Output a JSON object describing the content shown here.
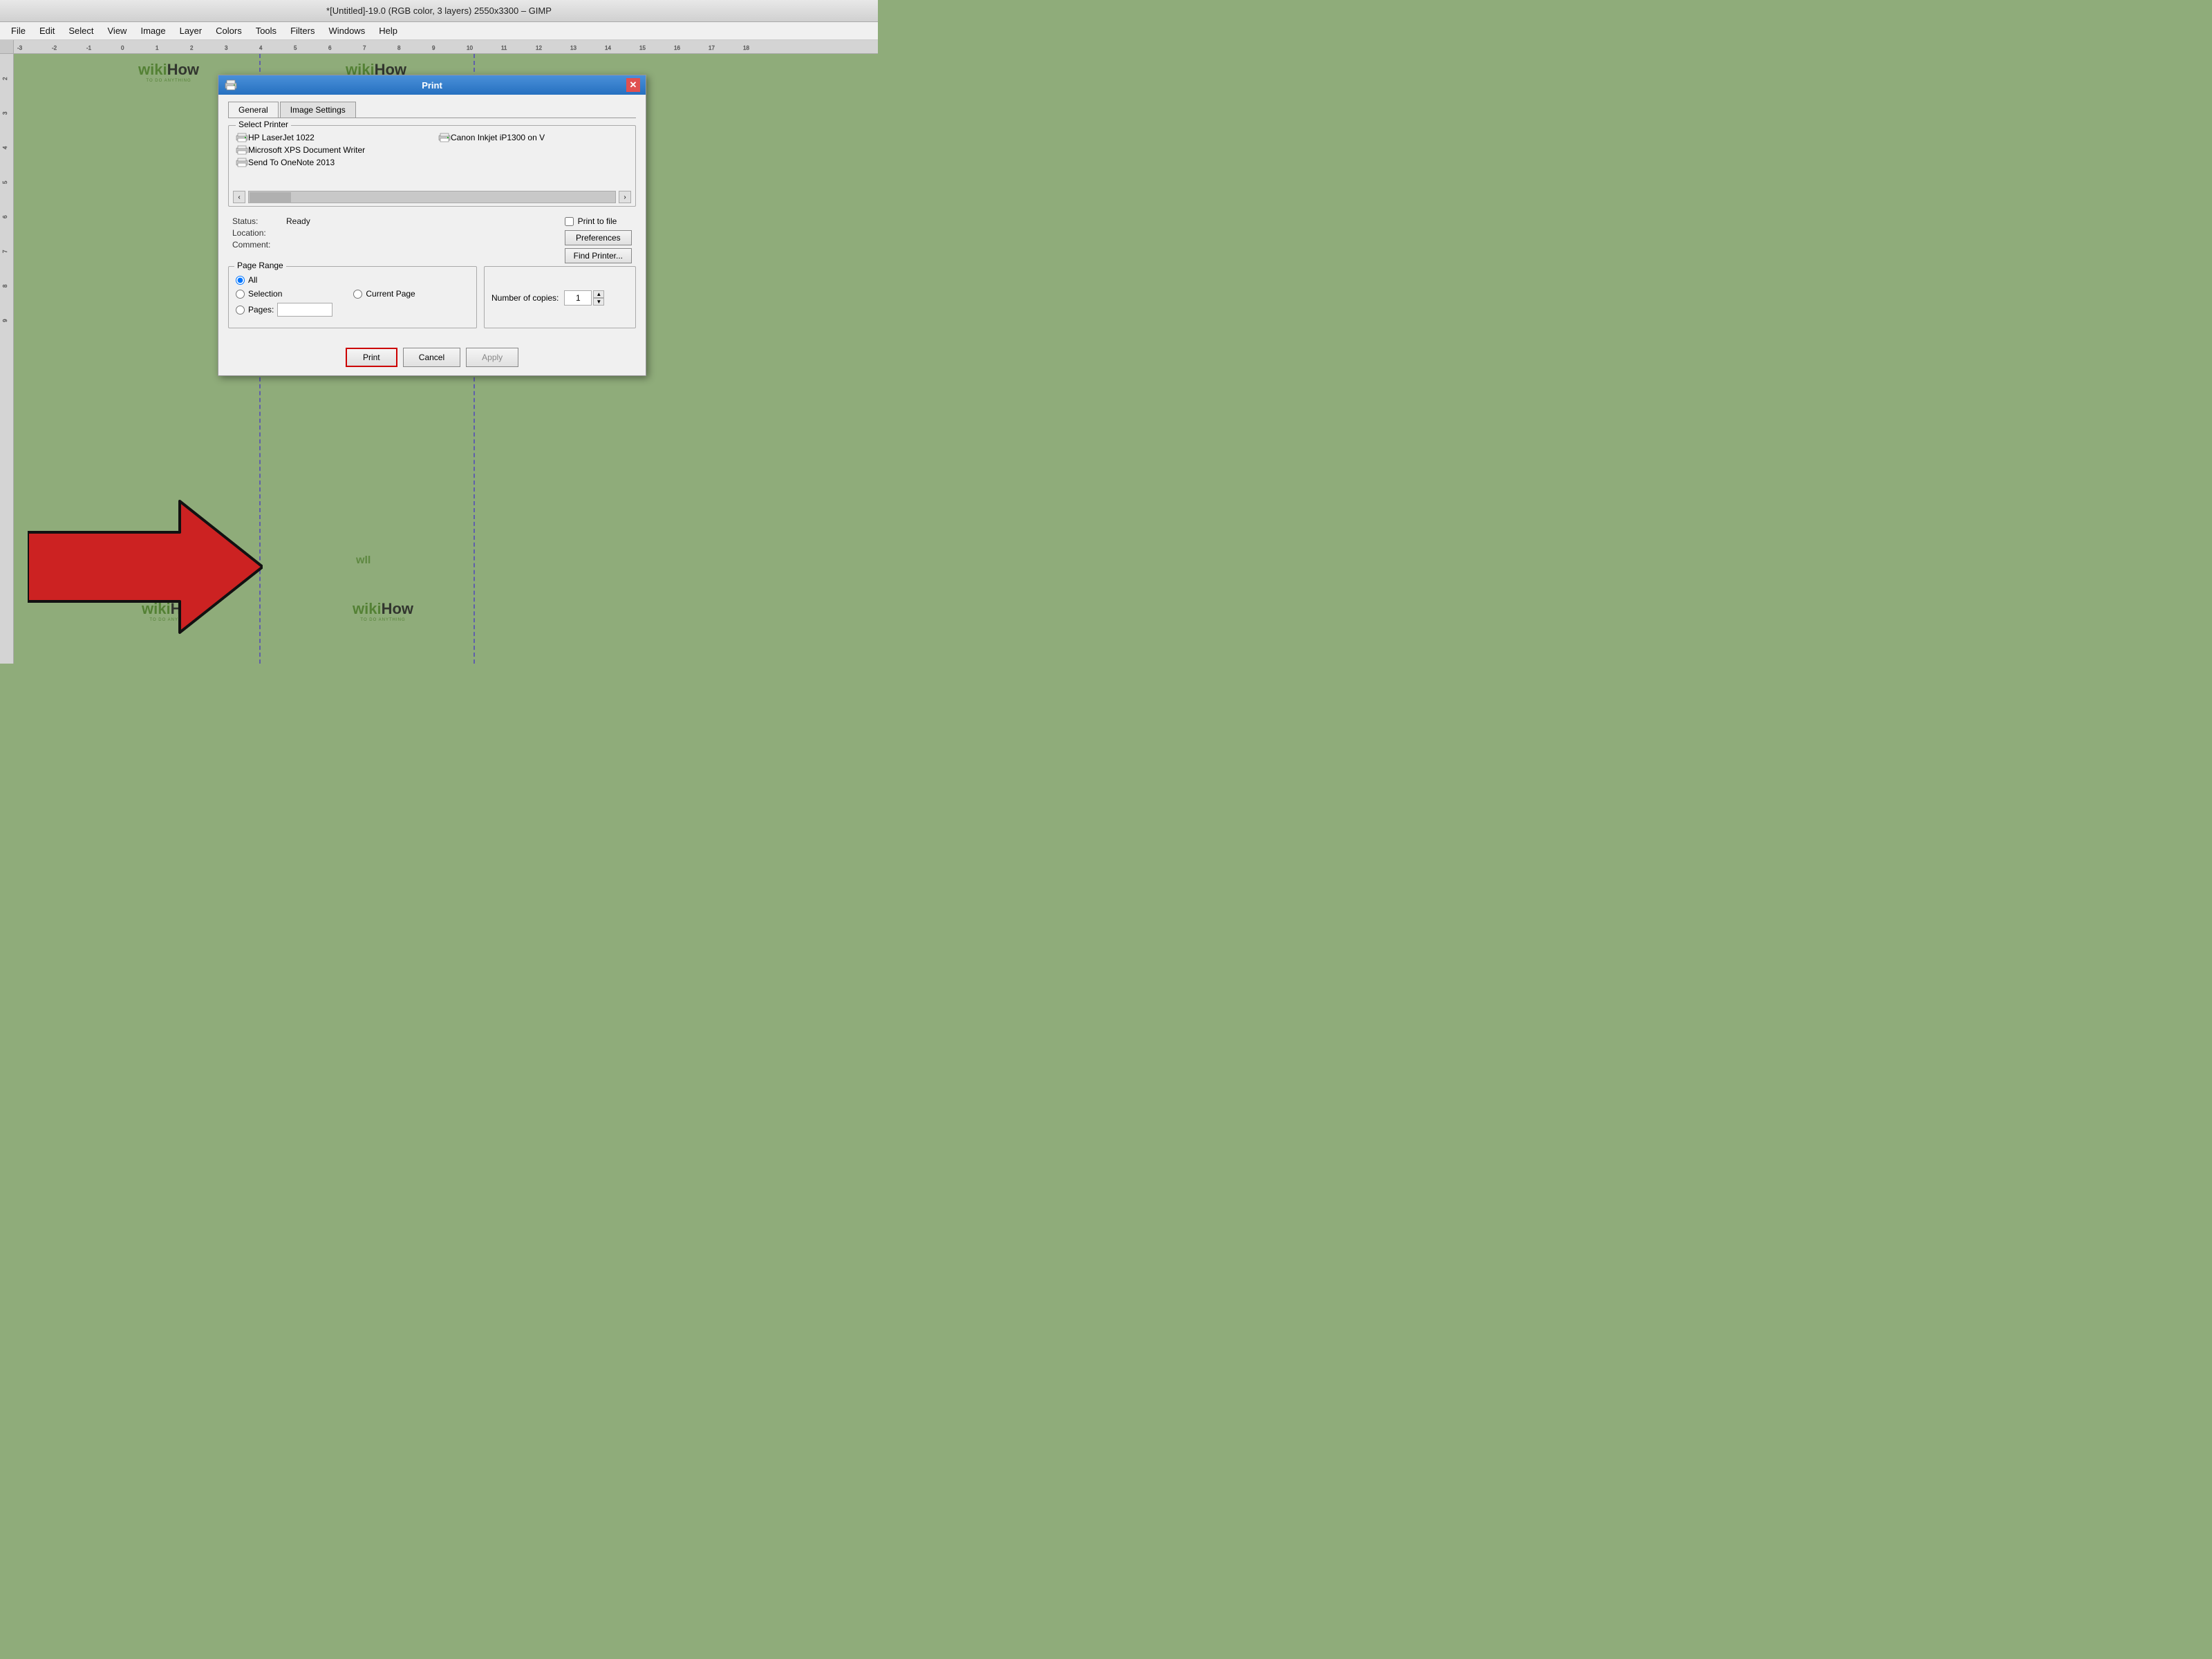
{
  "title": {
    "text": "*[Untitled]-19.0 (RGB color, 3 layers) 2550x3300 – GIMP"
  },
  "menubar": {
    "items": [
      "File",
      "Edit",
      "Select",
      "View",
      "Image",
      "Layer",
      "Colors",
      "Tools",
      "Filters",
      "Windows",
      "Help"
    ]
  },
  "dialog": {
    "title": "Print",
    "tabs": [
      "General",
      "Image Settings"
    ],
    "activeTab": "General",
    "selectPrinterLabel": "Select Printer",
    "printers": [
      {
        "name": "HP LaserJet 1022"
      },
      {
        "name": "Canon Inkjet iP1300 on V"
      },
      {
        "name": "Microsoft XPS Document Writer"
      },
      {
        "name": "Send To OneNote 2013"
      }
    ],
    "status": {
      "label": "Status:",
      "value": "Ready",
      "locationLabel": "Location:",
      "locationValue": "",
      "commentLabel": "Comment:",
      "commentValue": ""
    },
    "printToFile": {
      "label": "Print to file",
      "checked": false
    },
    "buttons": {
      "preferences": "Preferences",
      "findPrinter": "Find Printer..."
    },
    "pageRange": {
      "label": "Page Range",
      "options": [
        {
          "id": "all",
          "label": "All",
          "checked": true
        },
        {
          "id": "selection",
          "label": "Selection",
          "checked": false
        },
        {
          "id": "currentPage",
          "label": "Current Page",
          "checked": false
        },
        {
          "id": "pages",
          "label": "Pages:",
          "checked": false
        }
      ],
      "pagesValue": ""
    },
    "copies": {
      "label": "Number of copies:",
      "value": "1"
    },
    "footer": {
      "printLabel": "Print",
      "cancelLabel": "Cancel",
      "applyLabel": "Apply"
    }
  }
}
